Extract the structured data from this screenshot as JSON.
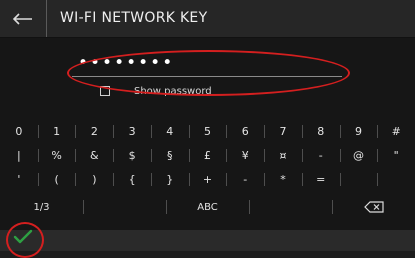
{
  "header": {
    "title": "WI-FI NETWORK KEY",
    "back_icon": "back-arrow-icon"
  },
  "password": {
    "value": "••••••••",
    "show_label": "Show password",
    "show_checked": false
  },
  "annotation_color": "#d41f1f",
  "keyboard": {
    "row1": [
      "0",
      "1",
      "2",
      "3",
      "4",
      "5",
      "6",
      "7",
      "8",
      "9",
      "#"
    ],
    "row2": [
      "|",
      "%",
      "&",
      "$",
      "§",
      "£",
      "¥",
      "¤",
      "-",
      "@",
      "\""
    ],
    "row3": [
      "'",
      "(",
      ")",
      "{",
      "}",
      "+",
      "-",
      "*",
      "=",
      "",
      ""
    ],
    "row4": {
      "page": "1/3",
      "blank_left": "",
      "mode": "ABC",
      "blank_right": "",
      "backspace_icon": "backspace-icon"
    }
  },
  "footer": {
    "confirm_icon": "checkmark-icon",
    "confirm_color": "#2ea043"
  }
}
